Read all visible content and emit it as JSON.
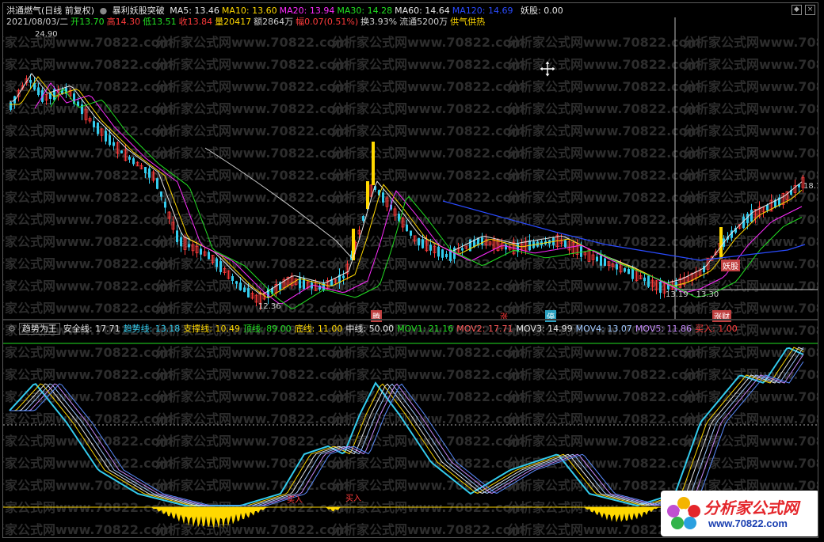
{
  "title_bar": {
    "stock_name": "洪通燃气(日线 前复权)",
    "formula": "暴利妖股突破",
    "ma": [
      {
        "label": "MA5: 13.46",
        "color": "#e6e6e6"
      },
      {
        "label": "MA10: 13.60",
        "color": "#ffd800"
      },
      {
        "label": "MA20: 13.94",
        "color": "#ff2bff"
      },
      {
        "label": "MA30: 14.28",
        "color": "#22e022"
      },
      {
        "label": "MA60: 14.64",
        "color": "#e6e6e6"
      },
      {
        "label": "MA120: 14.69",
        "color": "#2a4bff"
      }
    ],
    "yaogu": "妖股: 0.00"
  },
  "quote_bar": [
    {
      "text": "2021/08/03/二",
      "color": "#cfcfcf"
    },
    {
      "text": "开13.70",
      "color": "#22e022"
    },
    {
      "text": "高14.30",
      "color": "#ff3b3b"
    },
    {
      "text": "低13.51",
      "color": "#22e022"
    },
    {
      "text": "收13.84",
      "color": "#ff3b3b"
    },
    {
      "text": "量20417",
      "color": "#ffd800"
    },
    {
      "text": "额2864万",
      "color": "#cfcfcf"
    },
    {
      "text": "幅0.07(0.51%)",
      "color": "#ff3b3b"
    },
    {
      "text": "换3.93%",
      "color": "#cfcfcf"
    },
    {
      "text": "流通5200万",
      "color": "#cfcfcf"
    },
    {
      "text": "供气供热",
      "color": "#ffd800"
    }
  ],
  "price_labels": {
    "high": "24.90",
    "low": "12.36",
    "right_price": "18.1",
    "range": "13.19 - 13.30",
    "yaogu_tag": "妖股",
    "marker_1": "腾",
    "marker_2": "涨",
    "marker_3": "停",
    "marker_4": "涨财"
  },
  "indicator_bar": [
    {
      "text": "趋势为王",
      "color": "#e6e6e6"
    },
    {
      "text": "安全线: 17.71",
      "color": "#e6e6e6"
    },
    {
      "text": "趋势线: 13.18",
      "color": "#33ccee"
    },
    {
      "text": "支撑线: 10.49",
      "color": "#ffd800"
    },
    {
      "text": "顶线: 89.00",
      "color": "#22e022"
    },
    {
      "text": "底线: 11.00",
      "color": "#ffd800"
    },
    {
      "text": "中线: 50.00",
      "color": "#e6e6e6"
    },
    {
      "text": "MOV1: 21.16",
      "color": "#22e022"
    },
    {
      "text": "MOV2: 17.71",
      "color": "#ff5a5a"
    },
    {
      "text": "MOV3: 14.99",
      "color": "#e6e6e6"
    },
    {
      "text": "MOV4: 13.07",
      "color": "#a0c8ff"
    },
    {
      "text": "MOV5: 11.86",
      "color": "#c88cff"
    },
    {
      "text": "买入: 1.00",
      "color": "#ff3b3b"
    }
  ],
  "buy_tags": [
    "买入",
    "买入"
  ],
  "watermark": "分析家公式网www.70822.com",
  "logo": {
    "name": "分析家公式网",
    "url": "www.70822.com"
  }
}
